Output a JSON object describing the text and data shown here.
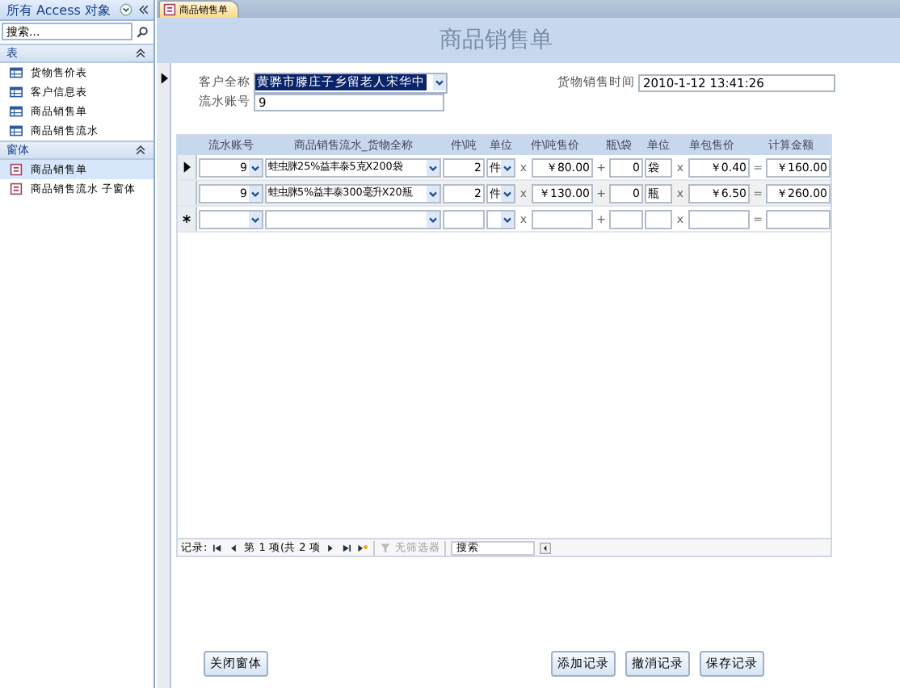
{
  "nav_pane": {
    "title": "所有 Access 对象",
    "search": {
      "placeholder": "搜索..."
    },
    "groups": [
      {
        "label": "表",
        "expanded": true,
        "items": [
          {
            "label": "货物售价表",
            "kind": "table",
            "selected": false
          },
          {
            "label": "客户信息表",
            "kind": "table",
            "selected": false
          },
          {
            "label": "商品销售单",
            "kind": "table",
            "selected": false
          },
          {
            "label": "商品销售流水",
            "kind": "table",
            "selected": false
          }
        ]
      },
      {
        "label": "窗体",
        "expanded": true,
        "items": [
          {
            "label": "商品销售单",
            "kind": "form",
            "selected": true
          },
          {
            "label": "商品销售流水 子窗体",
            "kind": "form",
            "selected": false
          }
        ]
      }
    ]
  },
  "tabs": [
    {
      "label": "商品销售单",
      "selected": true
    }
  ],
  "form": {
    "title": "商品销售单",
    "customer": {
      "label": "客户全称",
      "value": "黄骅市滕庄子乡留老人宋华中"
    },
    "account": {
      "label": "流水账号",
      "value": "9"
    },
    "time": {
      "label": "货物销售时间",
      "value": "2010-1-12 13:41:26"
    },
    "subform": {
      "columns": [
        "流水账号",
        "商品销售流水_货物全称",
        "件\\吨",
        "单位",
        "件\\吨售价",
        "瓶\\袋",
        "单位",
        "单包售价",
        "计算金额"
      ],
      "rows": [
        {
          "kind": "current",
          "account": "9",
          "product": "蛙虫脒25%益丰泰5克X200袋",
          "qty": "2",
          "unit": "件",
          "ops": [
            "x",
            "+",
            "x",
            "="
          ],
          "price": "￥80.00",
          "bags": "0",
          "bag_unit": "袋",
          "unit_price": "￥0.40",
          "amount": "￥160.00"
        },
        {
          "kind": "saved",
          "account": "9",
          "product": "蛙虫脒5%益丰泰300毫升X20瓶",
          "qty": "2",
          "unit": "件",
          "ops": [
            "x",
            "+",
            "x",
            "="
          ],
          "price": "￥130.00",
          "bags": "0",
          "bag_unit": "瓶",
          "unit_price": "￥6.50",
          "amount": "￥260.00"
        },
        {
          "kind": "new",
          "ops": [
            "x",
            "+",
            "x",
            "="
          ]
        }
      ],
      "navigator": {
        "label": "记录:",
        "position": "第 1 项(共 2 项",
        "filter": "无筛选器",
        "search": "搜索"
      }
    },
    "buttons_left": [
      "关闭窗体"
    ],
    "buttons_right": [
      "添加记录",
      "撤消记录",
      "保存记录"
    ]
  }
}
